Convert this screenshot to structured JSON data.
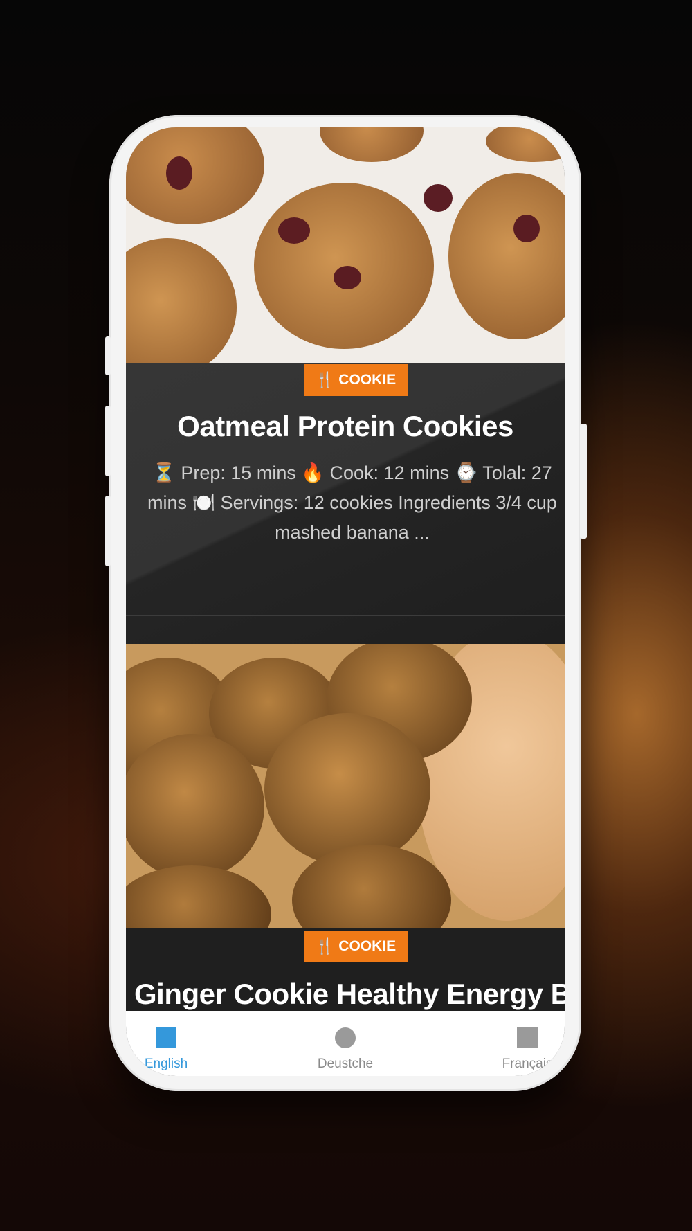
{
  "recipes": [
    {
      "category": "COOKIE",
      "title": "Oatmeal Protein Cookies",
      "description": "⏳ Prep: 15 mins 🔥 Cook: 12 mins ⌚ Tolal: 27 mins 🍽️ Servings: 12 cookies Ingredients 3/4 cup mashed banana ..."
    },
    {
      "category": "COOKIE",
      "title": "Ginger Cookie Healthy Energy Balls"
    }
  ],
  "bottom_nav": [
    {
      "label": "English",
      "icon": "square-icon",
      "active": true
    },
    {
      "label": "Deustche",
      "icon": "circle-icon",
      "active": false
    },
    {
      "label": "Français",
      "icon": "square-icon",
      "active": false
    }
  ],
  "colors": {
    "accent": "#f07a16",
    "nav_active": "#3498db",
    "nav_inactive": "#9a9a9a"
  }
}
